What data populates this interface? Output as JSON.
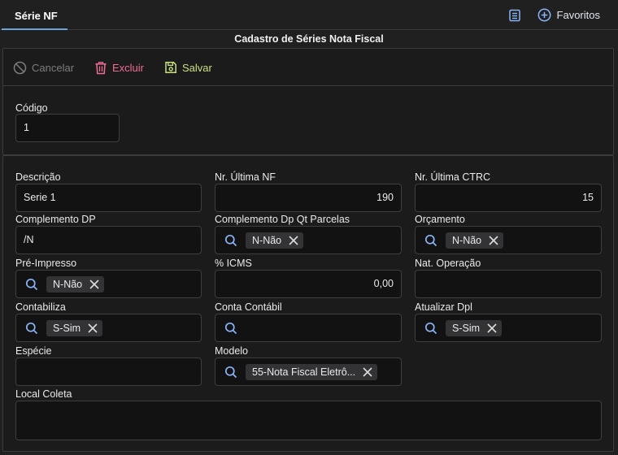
{
  "tab": {
    "label": "Série NF"
  },
  "top_actions": {
    "favorites_label": "Favoritos",
    "list_icon": "list-icon",
    "favorites_icon": "plus-circle-icon"
  },
  "page_title": "Cadastro de Séries Nota Fiscal",
  "toolbar": {
    "cancel_label": "Cancelar",
    "delete_label": "Excluir",
    "save_label": "Salvar"
  },
  "codigo": {
    "label": "Código",
    "value": "1"
  },
  "fields": {
    "descricao": {
      "label": "Descrição",
      "value": "Serie 1"
    },
    "nr_ultima_nf": {
      "label": "Nr. Última NF",
      "value": "190"
    },
    "nr_ultima_ctrc": {
      "label": "Nr. Última CTRC",
      "value": "15"
    },
    "complemento_dp": {
      "label": "Complemento DP",
      "value": "/N"
    },
    "complemento_dp_qt": {
      "label": "Complemento Dp Qt Parcelas",
      "chip": "N-Não"
    },
    "orcamento": {
      "label": "Orçamento",
      "chip": "N-Não"
    },
    "pre_impresso": {
      "label": "Pré-Impresso",
      "chip": "N-Não"
    },
    "icms": {
      "label": "% ICMS",
      "value": "0,00"
    },
    "nat_operacao": {
      "label": "Nat. Operação",
      "value": ""
    },
    "contabiliza": {
      "label": "Contabiliza",
      "chip": "S-Sim"
    },
    "conta_contabil": {
      "label": "Conta Contábil"
    },
    "atualizar_dpl": {
      "label": "Atualizar Dpl",
      "chip": "S-Sim"
    },
    "especie": {
      "label": "Espécie",
      "value": ""
    },
    "modelo": {
      "label": "Modelo",
      "chip": "55-Nota Fiscal Eletrô..."
    },
    "local_coleta": {
      "label": "Local Coleta",
      "value": ""
    }
  },
  "colors": {
    "accent": "#6ea2d8",
    "delete": "#ee6d93",
    "save": "#c8e07e",
    "disabled": "#7c7c7c",
    "search_icon": "#8ab4f8"
  }
}
